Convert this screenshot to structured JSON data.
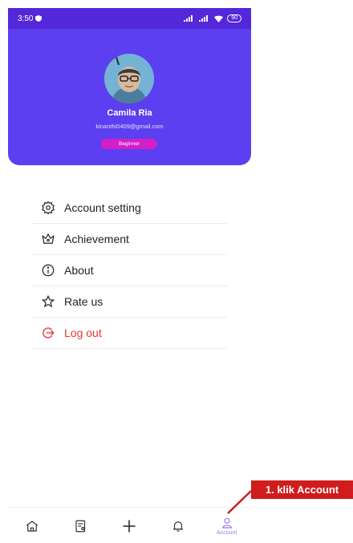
{
  "status_bar": {
    "time": "3:50",
    "battery": "90"
  },
  "profile": {
    "name": "Camila Ria",
    "email": "kinanthi0409@gmail.com",
    "level": "Beginner"
  },
  "menu": {
    "items": [
      {
        "label": "Account setting",
        "icon": "gear-icon"
      },
      {
        "label": "Achievement",
        "icon": "crown-icon"
      },
      {
        "label": "About",
        "icon": "info-icon"
      },
      {
        "label": "Rate us",
        "icon": "star-icon"
      },
      {
        "label": "Log out",
        "icon": "logout-icon"
      }
    ]
  },
  "bottom_nav": {
    "account_label": "Account"
  },
  "annotation": {
    "text": "1. klik Account"
  },
  "colors": {
    "header": "#5b3ff0",
    "status_bar": "#5328d8",
    "badge": "#d21fc8",
    "logout": "#e53935",
    "accent": "#9b7af2",
    "callout": "#d01c1c"
  }
}
